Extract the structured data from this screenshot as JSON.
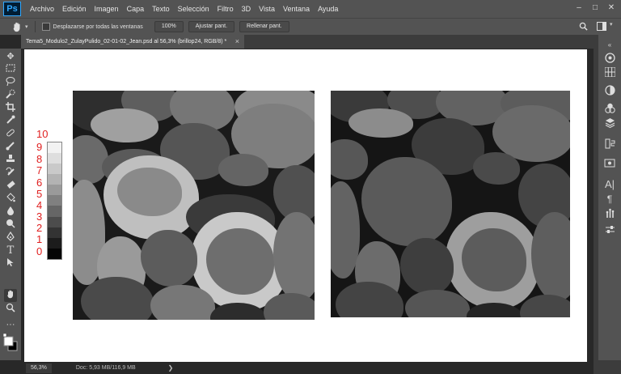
{
  "app": {
    "logo": "Ps"
  },
  "menu": [
    "Archivo",
    "Edición",
    "Imagen",
    "Capa",
    "Texto",
    "Selección",
    "Filtro",
    "3D",
    "Vista",
    "Ventana",
    "Ayuda"
  ],
  "window_controls": {
    "minimize": "–",
    "maximize": "□",
    "close": "✕"
  },
  "options_bar": {
    "scroll_all_label": "Desplazarse por todas las ventanas",
    "zoom_value": "100%",
    "fit_screen": "Ajustar pant.",
    "fill_screen": "Rellenar pant."
  },
  "document_tab": {
    "title": "Tema5_Modulo2_ZulayPulido_02-01-02_Jean.psd al 56,3% (brillop24, RGB/8) *",
    "close": "×"
  },
  "scale": [
    "10",
    "9",
    "8",
    "7",
    "6",
    "5",
    "4",
    "3",
    "2",
    "1",
    "0"
  ],
  "scale_colors": [
    "#f2f2f2",
    "#dedede",
    "#c9c9c9",
    "#b3b3b3",
    "#9a9a9a",
    "#808080",
    "#666666",
    "#4c4c4c",
    "#333333",
    "#1c1c1c",
    "#050505"
  ],
  "scale_color": "#e02020",
  "status_bar": {
    "zoom": "56,3%",
    "doc_info": "Doc: 5,93 MB/116,9 MB",
    "arrow": "❯"
  },
  "tools": [
    "move-icon",
    "marquee-icon",
    "lasso-icon",
    "quick-select-icon",
    "crop-icon",
    "eyedropper-icon",
    "healing-icon",
    "brush-icon",
    "stamp-icon",
    "history-brush-icon",
    "eraser-icon",
    "bucket-icon",
    "blur-icon",
    "dodge-icon",
    "pen-icon",
    "type-icon",
    "path-select-icon",
    "hand-icon",
    "zoom-icon",
    "more-icon"
  ],
  "right_panel_icons": [
    "color-icon",
    "swatches-icon",
    "adjustments-icon",
    "styles-icon",
    "layers-icon",
    "channels-icon",
    "paths-icon",
    "character-icon",
    "paragraph-icon",
    "glyphs-icon",
    "properties-icon"
  ]
}
